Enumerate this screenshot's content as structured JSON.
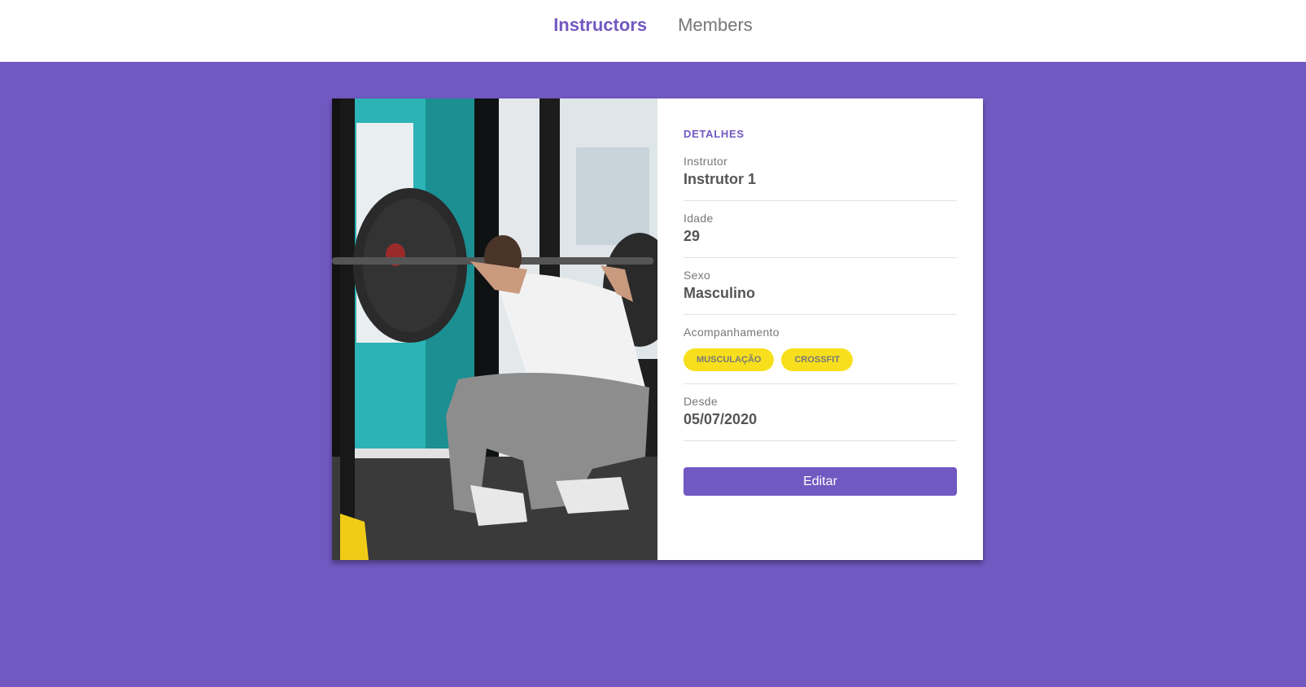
{
  "nav": {
    "instructors_label": "Instructors",
    "members_label": "Members"
  },
  "details": {
    "heading": "DETALHES",
    "fields": [
      {
        "label": "Instrutor",
        "value": "Instrutor 1"
      },
      {
        "label": "Idade",
        "value": "29"
      },
      {
        "label": "Sexo",
        "value": "Masculino"
      },
      {
        "label": "Acompanhamento",
        "tags": [
          "MUSCULAÇÃO",
          "CROSSFIT"
        ]
      },
      {
        "label": "Desde",
        "value": "05/07/2020"
      }
    ],
    "edit_label": "Editar"
  },
  "colors": {
    "primary": "#7159c1",
    "tag": "#f7df1e"
  },
  "photo": {
    "icon": "barbell-squat-photo"
  }
}
